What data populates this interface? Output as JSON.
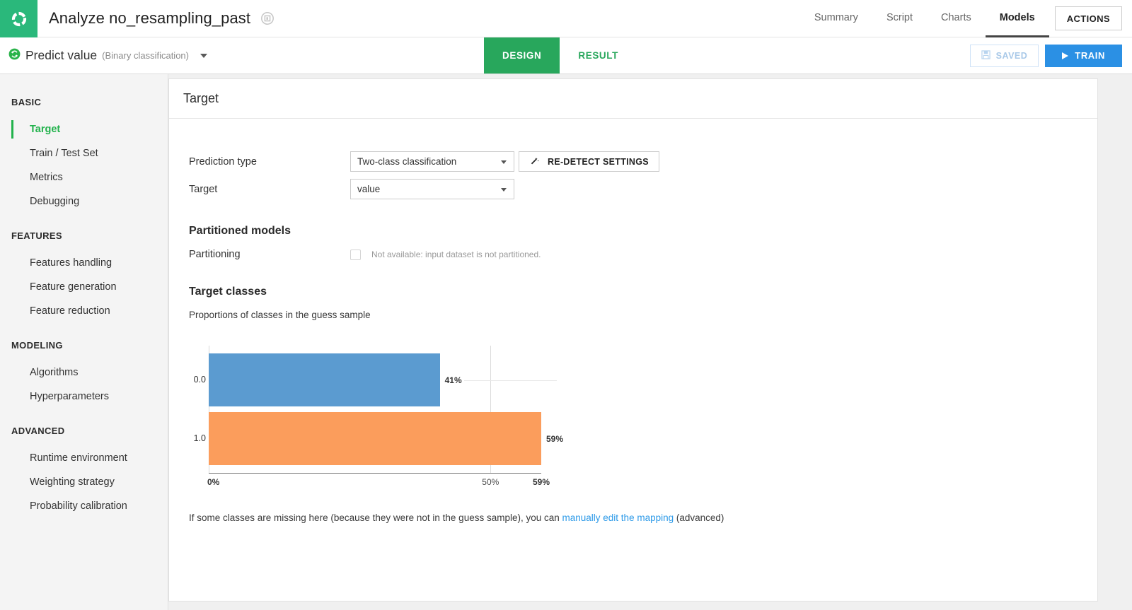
{
  "topbar": {
    "logo_icon": "dataiku-logo-icon",
    "title": "Analyze no_resampling_past",
    "title_badge_icon": "dashboard-insight-icon",
    "tabs": [
      {
        "label": "Summary",
        "active": false
      },
      {
        "label": "Script",
        "active": false
      },
      {
        "label": "Charts",
        "active": false
      },
      {
        "label": "Models",
        "active": true
      }
    ],
    "actions_label": "ACTIONS"
  },
  "subbar": {
    "model_icon": "prediction-recipe-icon",
    "model_name": "Predict value",
    "model_kind": "(Binary classification)",
    "dropdown_icon": "caret-down-icon",
    "mode_tabs": [
      {
        "label": "DESIGN",
        "active": true
      },
      {
        "label": "RESULT",
        "active": false
      }
    ],
    "saved_label": "SAVED",
    "saved_icon": "floppy-disk-icon",
    "train_label": "TRAIN",
    "train_icon": "play-icon"
  },
  "sidebar": {
    "groups": [
      {
        "label": "BASIC",
        "items": [
          {
            "label": "Target",
            "active": true
          },
          {
            "label": "Train / Test Set",
            "active": false
          },
          {
            "label": "Metrics",
            "active": false
          },
          {
            "label": "Debugging",
            "active": false
          }
        ]
      },
      {
        "label": "FEATURES",
        "items": [
          {
            "label": "Features handling",
            "active": false
          },
          {
            "label": "Feature generation",
            "active": false
          },
          {
            "label": "Feature reduction",
            "active": false
          }
        ]
      },
      {
        "label": "MODELING",
        "items": [
          {
            "label": "Algorithms",
            "active": false
          },
          {
            "label": "Hyperparameters",
            "active": false
          }
        ]
      },
      {
        "label": "ADVANCED",
        "items": [
          {
            "label": "Runtime environment",
            "active": false
          },
          {
            "label": "Weighting strategy",
            "active": false
          },
          {
            "label": "Probability calibration",
            "active": false
          }
        ]
      }
    ]
  },
  "main": {
    "card_title": "Target",
    "prediction_type_label": "Prediction type",
    "prediction_type_value": "Two-class classification",
    "redetect_label": "RE-DETECT SETTINGS",
    "redetect_icon": "magic-wand-icon",
    "target_label": "Target",
    "target_value": "value",
    "partitioned_models_heading": "Partitioned models",
    "partitioning_label": "Partitioning",
    "partitioning_note": "Not available: input dataset is not partitioned.",
    "target_classes_heading": "Target classes",
    "proportions_caption": "Proportions of classes in the guess sample",
    "mapping_prefix": "If some classes are missing here (because they were not in the guess sample), you can ",
    "mapping_link": "manually edit the mapping",
    "mapping_suffix": " (advanced)"
  },
  "chart_data": {
    "type": "bar",
    "orientation": "horizontal",
    "title": "Proportions of classes in the guess sample",
    "categories": [
      "0.0",
      "1.0"
    ],
    "values": [
      41,
      59
    ],
    "value_labels": [
      "41%",
      "59%"
    ],
    "colors": [
      "#5b9bd0",
      "#fb9d5c"
    ],
    "xlabel": "",
    "ylabel": "",
    "xlim": [
      0,
      59
    ],
    "xticks": [
      0,
      50,
      59
    ],
    "xticklabels": [
      "0%",
      "50%",
      "59%"
    ],
    "grid": true,
    "legend": false
  },
  "colors": {
    "brand_green": "#2ab87b",
    "tab_green": "#28a75c",
    "accent_blue": "#2b90e4",
    "link_blue": "#2d9ae8",
    "bar_blue": "#5b9bd0",
    "bar_orange": "#fb9d5c"
  }
}
